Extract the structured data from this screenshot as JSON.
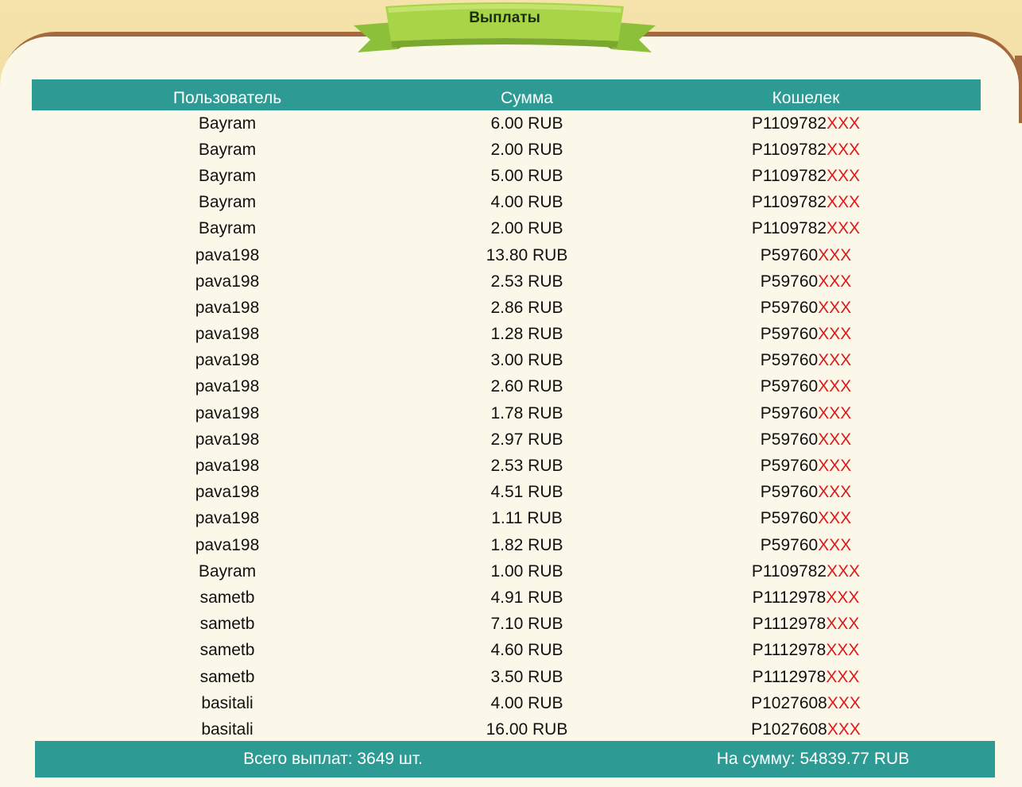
{
  "header": {
    "title": "Выплаты"
  },
  "table": {
    "columns": [
      "Пользователь",
      "Сумма",
      "Кошелек"
    ],
    "rows": [
      {
        "user": "Bayram",
        "amount": "6.00 RUB",
        "wallet": "P1109782",
        "wallet_mask": "XXX"
      },
      {
        "user": "Bayram",
        "amount": "2.00 RUB",
        "wallet": "P1109782",
        "wallet_mask": "XXX"
      },
      {
        "user": "Bayram",
        "amount": "5.00 RUB",
        "wallet": "P1109782",
        "wallet_mask": "XXX"
      },
      {
        "user": "Bayram",
        "amount": "4.00 RUB",
        "wallet": "P1109782",
        "wallet_mask": "XXX"
      },
      {
        "user": "Bayram",
        "amount": "2.00 RUB",
        "wallet": "P1109782",
        "wallet_mask": "XXX"
      },
      {
        "user": "pava198",
        "amount": "13.80 RUB",
        "wallet": "P59760",
        "wallet_mask": "XXX"
      },
      {
        "user": "pava198",
        "amount": "2.53 RUB",
        "wallet": "P59760",
        "wallet_mask": "XXX"
      },
      {
        "user": "pava198",
        "amount": "2.86 RUB",
        "wallet": "P59760",
        "wallet_mask": "XXX"
      },
      {
        "user": "pava198",
        "amount": "1.28 RUB",
        "wallet": "P59760",
        "wallet_mask": "XXX"
      },
      {
        "user": "pava198",
        "amount": "3.00 RUB",
        "wallet": "P59760",
        "wallet_mask": "XXX"
      },
      {
        "user": "pava198",
        "amount": "2.60 RUB",
        "wallet": "P59760",
        "wallet_mask": "XXX"
      },
      {
        "user": "pava198",
        "amount": "1.78 RUB",
        "wallet": "P59760",
        "wallet_mask": "XXX"
      },
      {
        "user": "pava198",
        "amount": "2.97 RUB",
        "wallet": "P59760",
        "wallet_mask": "XXX"
      },
      {
        "user": "pava198",
        "amount": "2.53 RUB",
        "wallet": "P59760",
        "wallet_mask": "XXX"
      },
      {
        "user": "pava198",
        "amount": "4.51 RUB",
        "wallet": "P59760",
        "wallet_mask": "XXX"
      },
      {
        "user": "pava198",
        "amount": "1.11 RUB",
        "wallet": "P59760",
        "wallet_mask": "XXX"
      },
      {
        "user": "pava198",
        "amount": "1.82 RUB",
        "wallet": "P59760",
        "wallet_mask": "XXX"
      },
      {
        "user": "Bayram",
        "amount": "1.00 RUB",
        "wallet": "P1109782",
        "wallet_mask": "XXX"
      },
      {
        "user": "sametb",
        "amount": "4.91 RUB",
        "wallet": "P1112978",
        "wallet_mask": "XXX"
      },
      {
        "user": "sametb",
        "amount": "7.10 RUB",
        "wallet": "P1112978",
        "wallet_mask": "XXX"
      },
      {
        "user": "sametb",
        "amount": "4.60 RUB",
        "wallet": "P1112978",
        "wallet_mask": "XXX"
      },
      {
        "user": "sametb",
        "amount": "3.50 RUB",
        "wallet": "P1112978",
        "wallet_mask": "XXX"
      },
      {
        "user": "basitali",
        "amount": "4.00 RUB",
        "wallet": "P1027608",
        "wallet_mask": "XXX"
      },
      {
        "user": "basitali",
        "amount": "16.00 RUB",
        "wallet": "P1027608",
        "wallet_mask": "XXX"
      }
    ]
  },
  "footer": {
    "total_count": "Всего выплат: 3649 шт.",
    "total_sum": "На сумму: 54839.77 RUB"
  },
  "colors": {
    "accent": "#2d9a94",
    "mask": "#e01818",
    "ribbon": "#a8d448",
    "frame": "#a46a3e",
    "background": "#fbf8ea"
  }
}
